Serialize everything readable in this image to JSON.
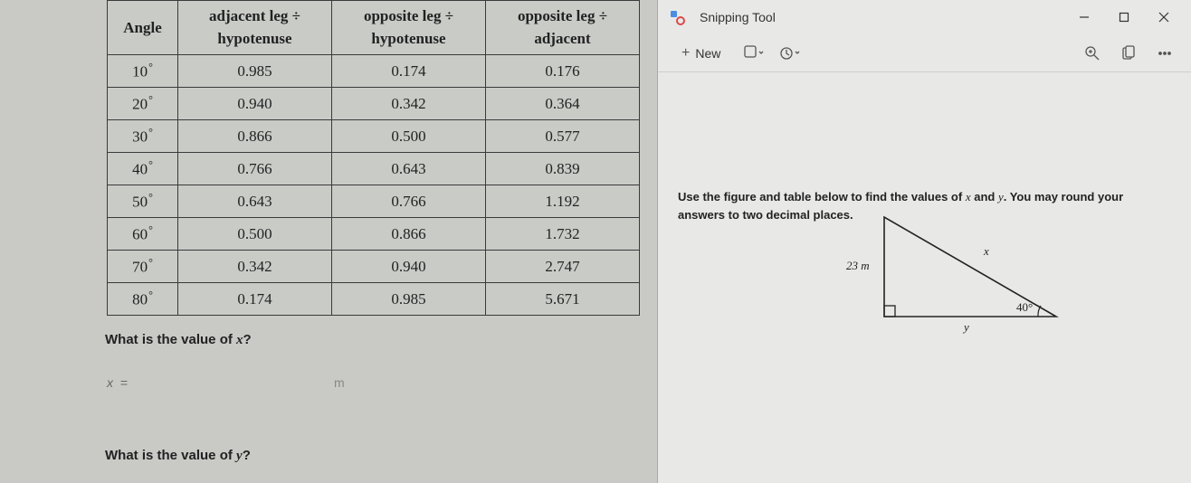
{
  "table": {
    "headers": {
      "angle": "Angle",
      "col1_top": "adjacent leg ÷",
      "col1_bot": "hypotenuse",
      "col2_top": "opposite leg ÷",
      "col2_bot": "hypotenuse",
      "col3_top": "opposite leg ÷",
      "col3_bot": "adjacent"
    },
    "rows": [
      {
        "angle": "10",
        "c1": "0.985",
        "c2": "0.174",
        "c3": "0.176"
      },
      {
        "angle": "20",
        "c1": "0.940",
        "c2": "0.342",
        "c3": "0.364"
      },
      {
        "angle": "30",
        "c1": "0.866",
        "c2": "0.500",
        "c3": "0.577"
      },
      {
        "angle": "40",
        "c1": "0.766",
        "c2": "0.643",
        "c3": "0.839"
      },
      {
        "angle": "50",
        "c1": "0.643",
        "c2": "0.766",
        "c3": "1.192"
      },
      {
        "angle": "60",
        "c1": "0.500",
        "c2": "0.866",
        "c3": "1.732"
      },
      {
        "angle": "70",
        "c1": "0.342",
        "c2": "0.940",
        "c3": "2.747"
      },
      {
        "angle": "80",
        "c1": "0.174",
        "c2": "0.985",
        "c3": "5.671"
      }
    ]
  },
  "questions": {
    "q1": "What is the value of x?",
    "x_var": "x",
    "x_eq": "=",
    "unit": "m",
    "q2": "What is the value of y?"
  },
  "snip": {
    "title": "Snipping Tool",
    "new": "New"
  },
  "problem": {
    "instruction_a": "Use the figure and table below to find the values of ",
    "instruction_b": " and ",
    "instruction_c": ". You may round your answers to two decimal places.",
    "var_x": "x",
    "var_y": "y",
    "side_label": "23 m",
    "angle_label": "40°",
    "label_x": "x",
    "label_y": "y"
  }
}
